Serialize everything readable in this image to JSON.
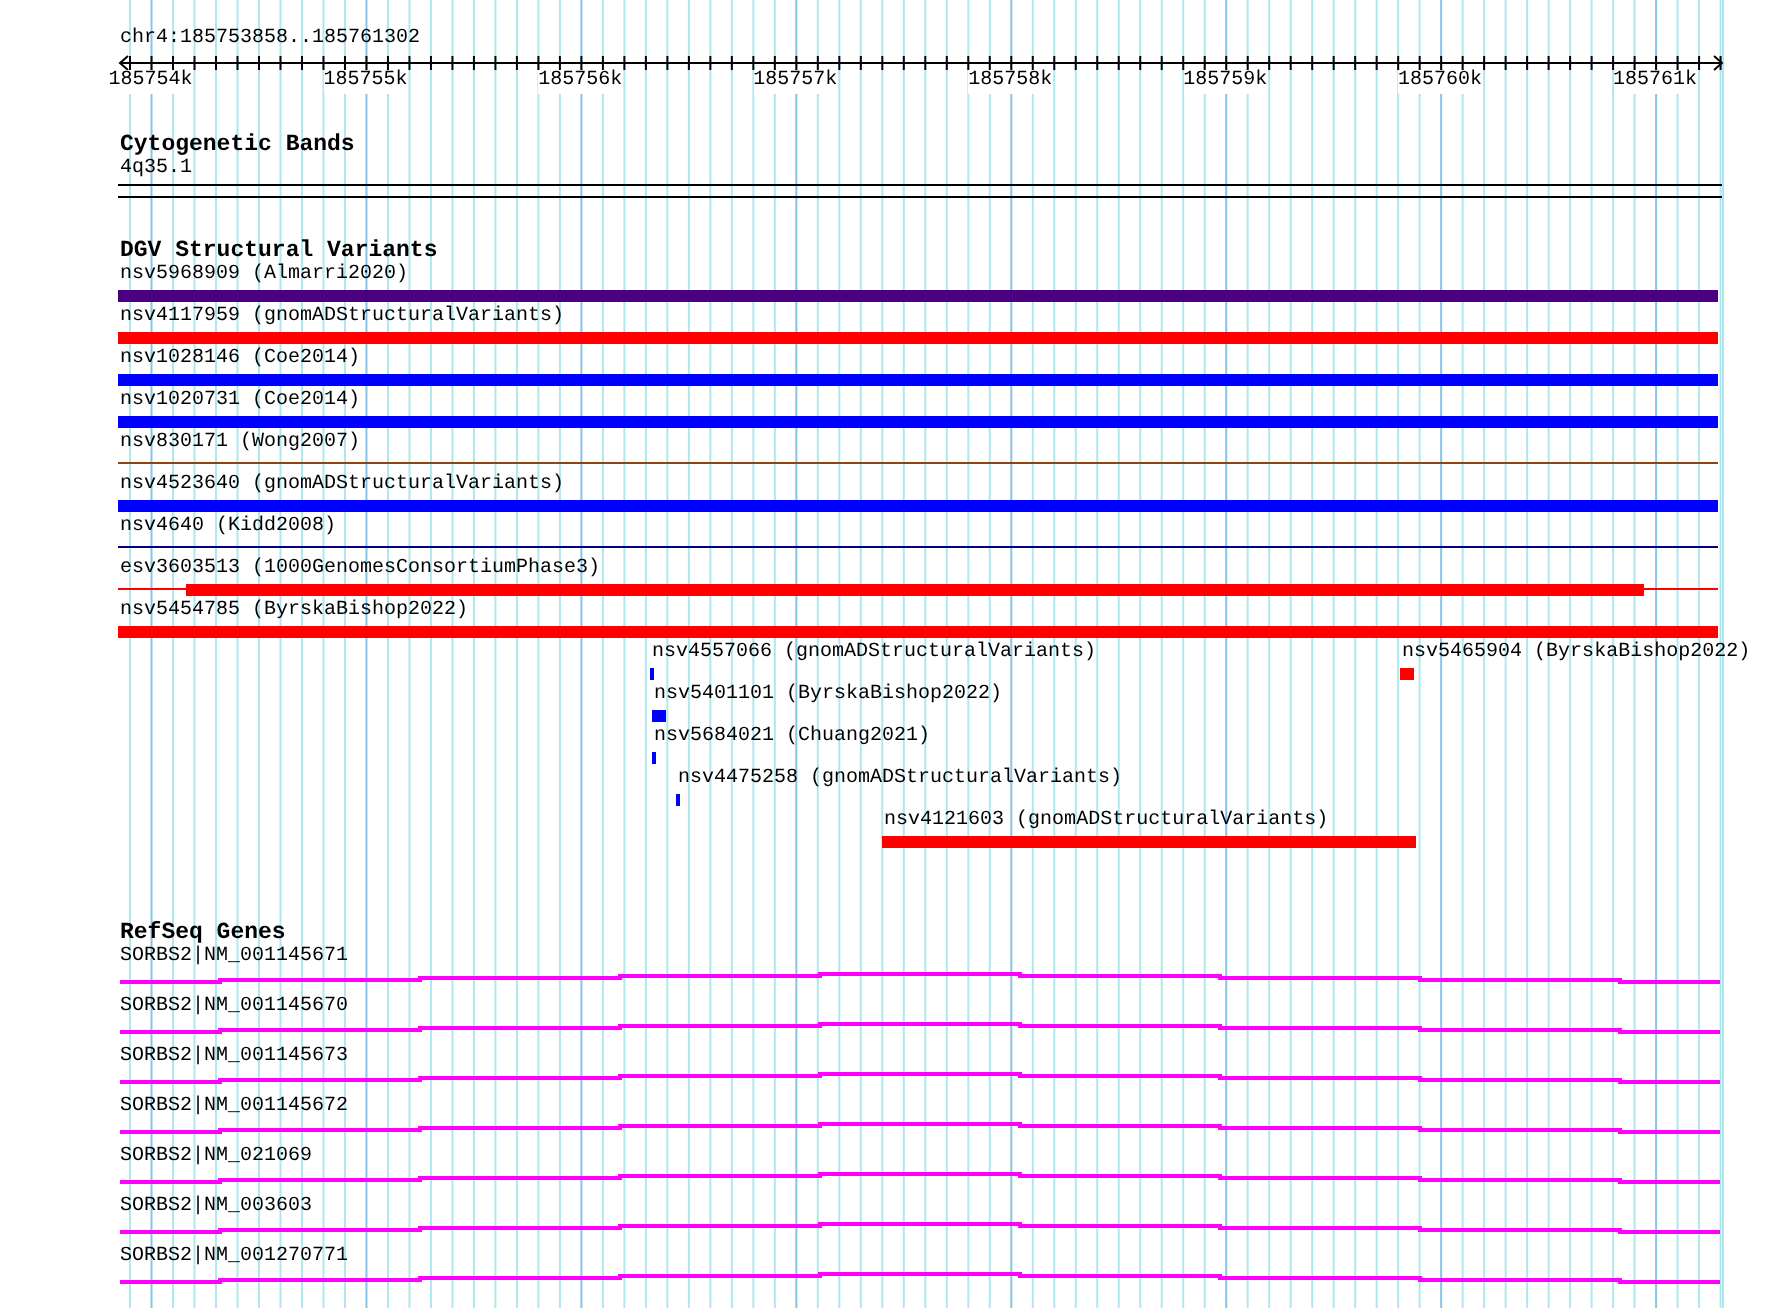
{
  "ruler": {
    "location": "chr4:185753858..185761302",
    "ticks": [
      {
        "label": "185754k"
      },
      {
        "label": "185755k"
      },
      {
        "label": "185756k"
      },
      {
        "label": "185757k"
      },
      {
        "label": "185758k"
      },
      {
        "label": "185759k"
      },
      {
        "label": "185760k"
      },
      {
        "label": "185761k"
      }
    ]
  },
  "cytobands": {
    "title": "Cytogenetic Bands",
    "bands": [
      {
        "label": "4q35.1"
      }
    ]
  },
  "variants": {
    "title": "DGV Structural Variants",
    "lanes": [
      {
        "features": [
          {
            "label": "nsv5968909 (Almarri2020)",
            "kind": "bar",
            "color": "#4b0082"
          }
        ]
      },
      {
        "features": [
          {
            "label": "nsv4117959 (gnomADStructuralVariants)",
            "kind": "bar",
            "color": "#ff0000"
          }
        ]
      },
      {
        "features": [
          {
            "label": "nsv1028146 (Coe2014)",
            "kind": "bar",
            "color": "#0000ff"
          }
        ]
      },
      {
        "features": [
          {
            "label": "nsv1020731 (Coe2014)",
            "kind": "bar",
            "color": "#0000ff"
          }
        ]
      },
      {
        "features": [
          {
            "label": "nsv830171 (Wong2007)",
            "kind": "line",
            "color": "#8b4513"
          }
        ]
      },
      {
        "features": [
          {
            "label": "nsv4523640 (gnomADStructuralVariants)",
            "kind": "bar",
            "color": "#0000ff"
          }
        ]
      },
      {
        "features": [
          {
            "label": "nsv4640 (Kidd2008)",
            "kind": "line",
            "color": "#000080"
          }
        ]
      },
      {
        "features": [
          {
            "label": "esv3603513 (1000GenomesConsortiumPhase3)",
            "kind": "thick",
            "color": "#ff0000"
          }
        ]
      },
      {
        "features": [
          {
            "label": "nsv5454785 (ByrskaBishop2022)",
            "kind": "bar",
            "color": "#ff0000"
          }
        ]
      },
      {
        "features": [
          {
            "label": "nsv4557066 (gnomADStructuralVariants)",
            "kind": "bar",
            "color": "#0000ff"
          },
          {
            "label": "nsv5465904 (ByrskaBishop2022)",
            "kind": "bar",
            "color": "#ff0000"
          }
        ]
      },
      {
        "features": [
          {
            "label": "nsv5401101 (ByrskaBishop2022)",
            "kind": "bar",
            "color": "#0000ff"
          }
        ]
      },
      {
        "features": [
          {
            "label": "nsv5684021 (Chuang2021)",
            "kind": "bar",
            "color": "#0000ff"
          }
        ]
      },
      {
        "features": [
          {
            "label": "nsv4475258 (gnomADStructuralVariants)",
            "kind": "bar",
            "color": "#0000ff"
          }
        ]
      },
      {
        "features": [
          {
            "label": "nsv4121603 (gnomADStructuralVariants)",
            "kind": "bar",
            "color": "#ff0000"
          }
        ]
      }
    ]
  },
  "genes": {
    "title": "RefSeq Genes",
    "items": [
      {
        "label": "SORBS2|NM_001145671"
      },
      {
        "label": "SORBS2|NM_001145670"
      },
      {
        "label": "SORBS2|NM_001145673"
      },
      {
        "label": "SORBS2|NM_001145672"
      },
      {
        "label": "SORBS2|NM_021069"
      },
      {
        "label": "SORBS2|NM_003603"
      },
      {
        "label": "SORBS2|NM_001270771"
      }
    ]
  }
}
